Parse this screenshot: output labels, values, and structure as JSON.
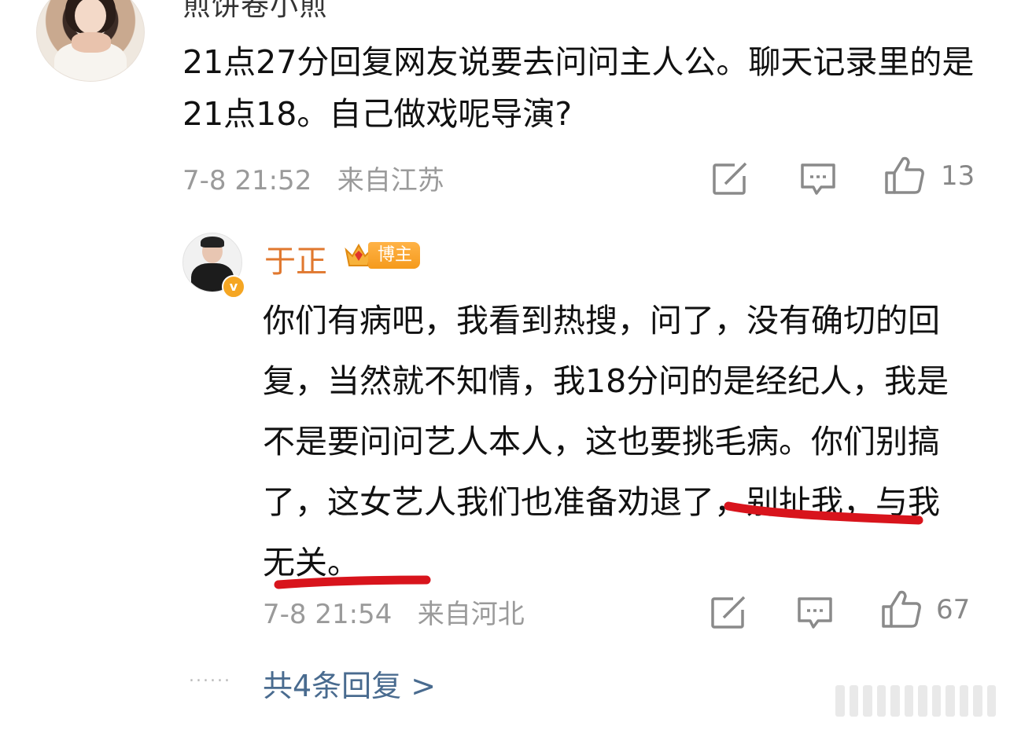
{
  "top_comment": {
    "author_partial": "煎饼卷小煎",
    "text": "21点27分回复网友说要去问问主人公。聊天记录里的是21点18。自己做戏呢导演?",
    "time": "7-8 21:52",
    "location": "来自江苏",
    "likes": "13"
  },
  "reply": {
    "author": "于正",
    "badge_label": "博主",
    "verified_icon": "v-verified-icon",
    "text": "你们有病吧，我看到热搜，问了，没有确切的回复，当然就不知情，我18分问的是经纪人，我是不是要问问艺人本人，这也要挑毛病。你们别搞了，这女艺人我们也准备劝退了，别扯我，与我无关。",
    "time": "7-8 21:54",
    "location": "来自河北",
    "likes": "67"
  },
  "more_replies": {
    "label": "共4条回复 >"
  },
  "colors": {
    "author_orange": "#e0782f",
    "link_blue": "#496b8f",
    "meta_gray": "#9a9a9a",
    "annotation_red": "#d8141c"
  }
}
